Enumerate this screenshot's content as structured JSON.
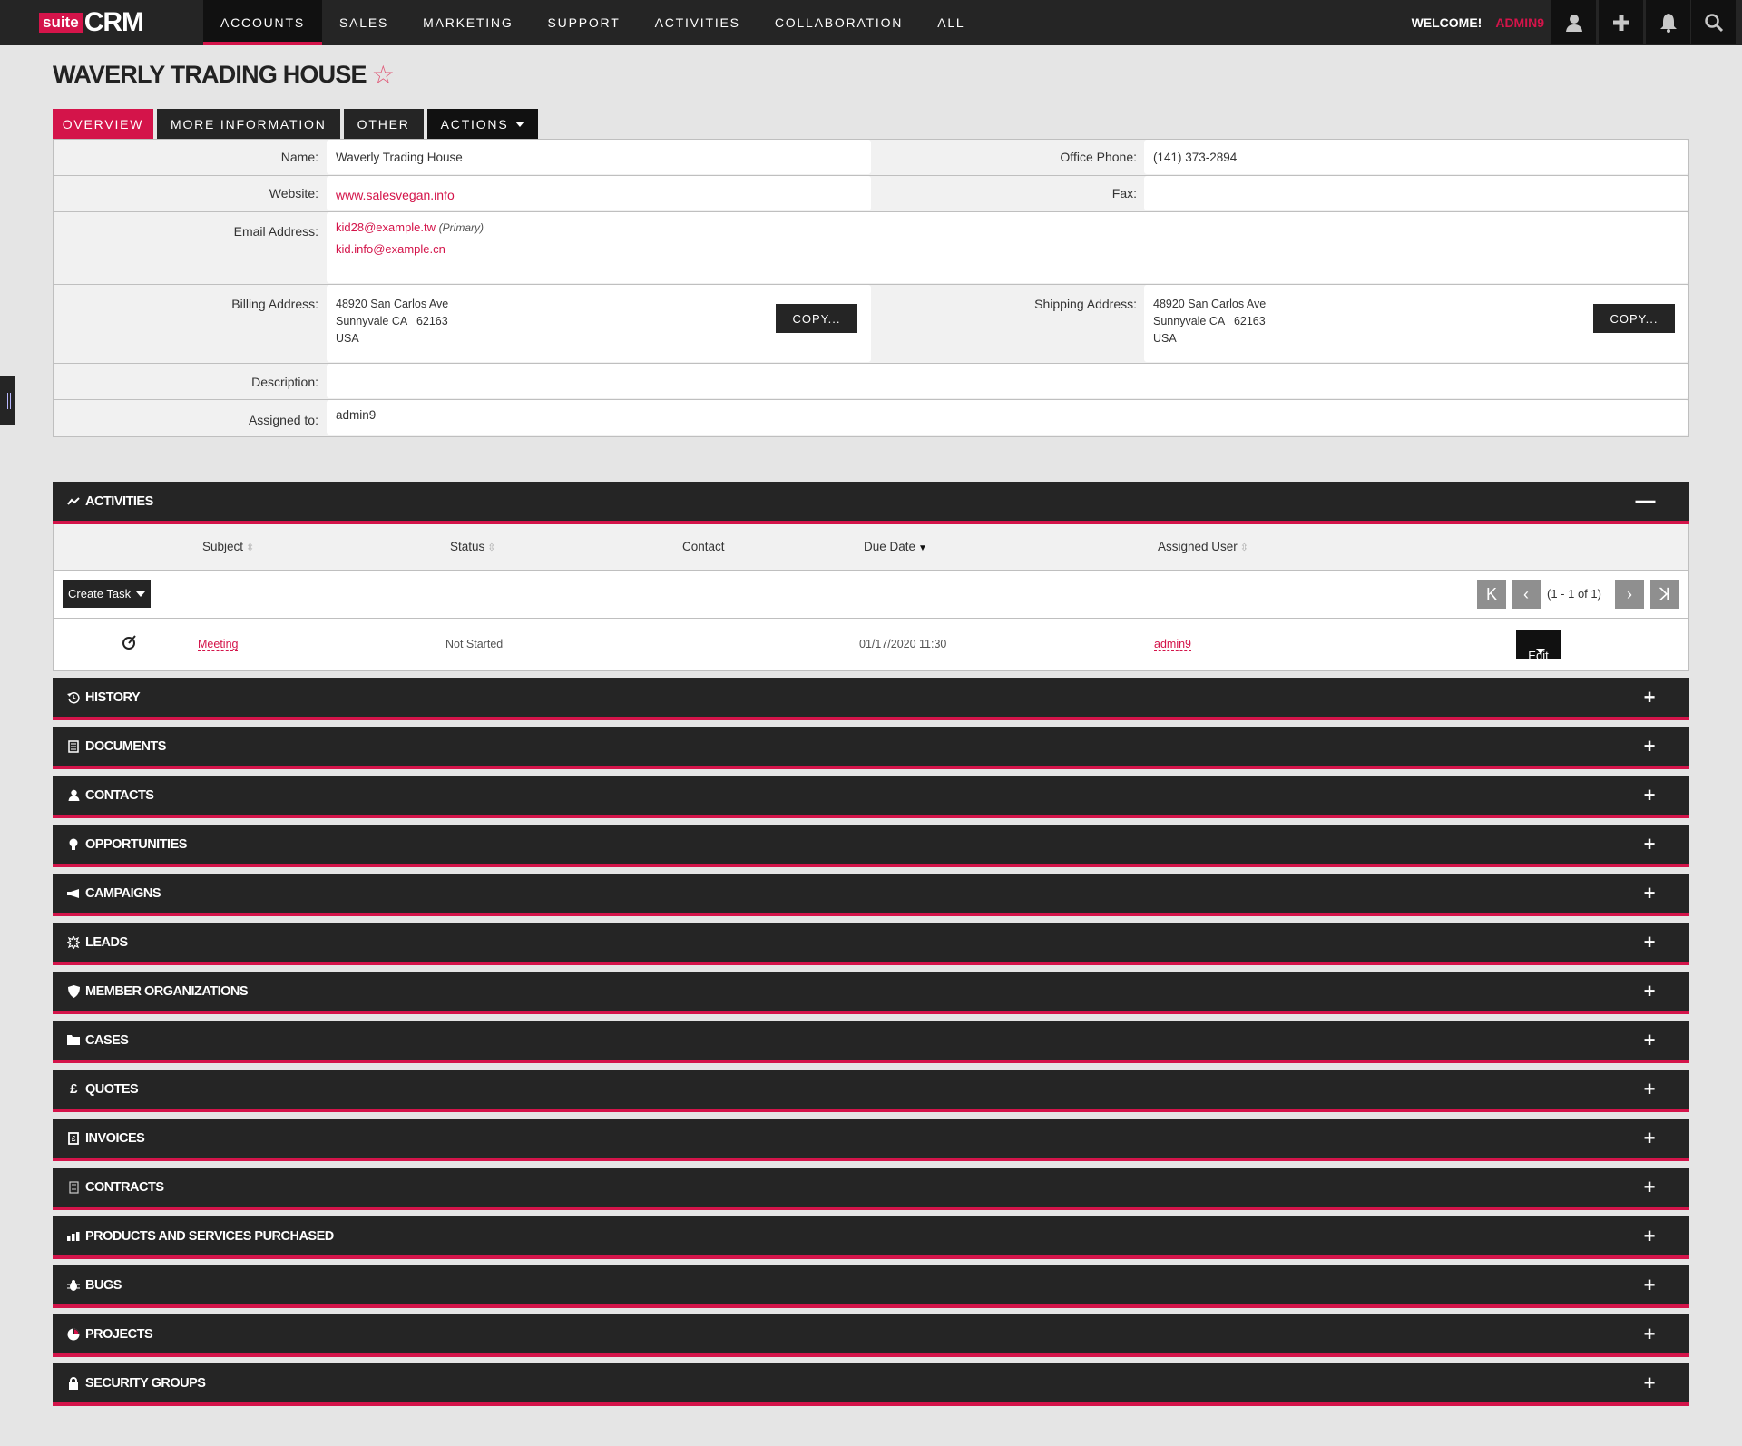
{
  "header": {
    "logo_suite": "suite",
    "logo_crm": "CRM",
    "nav": [
      "ACCOUNTS",
      "SALES",
      "MARKETING",
      "SUPPORT",
      "ACTIVITIES",
      "COLLABORATION",
      "ALL"
    ],
    "welcome": "WELCOME!",
    "username": "ADMIN9",
    "icons": [
      "user-icon",
      "plus-icon",
      "bell-icon",
      "search-icon"
    ]
  },
  "record": {
    "title": "WAVERLY TRADING HOUSE",
    "favorite_icon": "☆"
  },
  "tabs": [
    "OVERVIEW",
    "MORE INFORMATION",
    "OTHER",
    "ACTIONS"
  ],
  "fields": {
    "name_label": "Name:",
    "name": "Waverly Trading House",
    "office_phone_label": "Office Phone:",
    "office_phone": "(141) 373-2894",
    "website_label": "Website:",
    "website": "www.salesvegan.info",
    "fax_label": "Fax:",
    "fax": "",
    "email_label": "Email Address:",
    "email_primary": "kid28@example.tw",
    "email_primary_tag": "(Primary)",
    "email_secondary": "kid.info@example.cn",
    "billing_label": "Billing Address:",
    "billing_line1": "48920 San Carlos Ave",
    "billing_line2": "Sunnyvale CA   62163",
    "billing_line3": "USA",
    "shipping_label": "Shipping Address:",
    "shipping_line1": "48920 San Carlos Ave",
    "shipping_line2": "Sunnyvale CA   62163",
    "shipping_line3": "USA",
    "copy_label": "COPY...",
    "description_label": "Description:",
    "description": "",
    "assigned_label": "Assigned to:",
    "assigned": "admin9"
  },
  "activities": {
    "title": "ACTIVITIES",
    "columns": [
      "Subject",
      "Status",
      "Contact",
      "Due Date",
      "Assigned User"
    ],
    "create_task": "Create Task",
    "pagination": "(1 - 1 of 1)",
    "rows": [
      {
        "subject": "Meeting",
        "status": "Not Started",
        "contact": "",
        "due_date": "01/17/2020 11:30",
        "assigned_user": "admin9",
        "action": "Edit"
      }
    ]
  },
  "subpanels": [
    "HISTORY",
    "DOCUMENTS",
    "CONTACTS",
    "OPPORTUNITIES",
    "CAMPAIGNS",
    "LEADS",
    "MEMBER ORGANIZATIONS",
    "CASES",
    "QUOTES",
    "INVOICES",
    "CONTRACTS",
    "PRODUCTS AND SERVICES PURCHASED",
    "BUGS",
    "PROJECTS",
    "SECURITY GROUPS"
  ],
  "colors": {
    "accent": "#d4144a",
    "dark": "#252525",
    "background": "#e5e5e5"
  }
}
